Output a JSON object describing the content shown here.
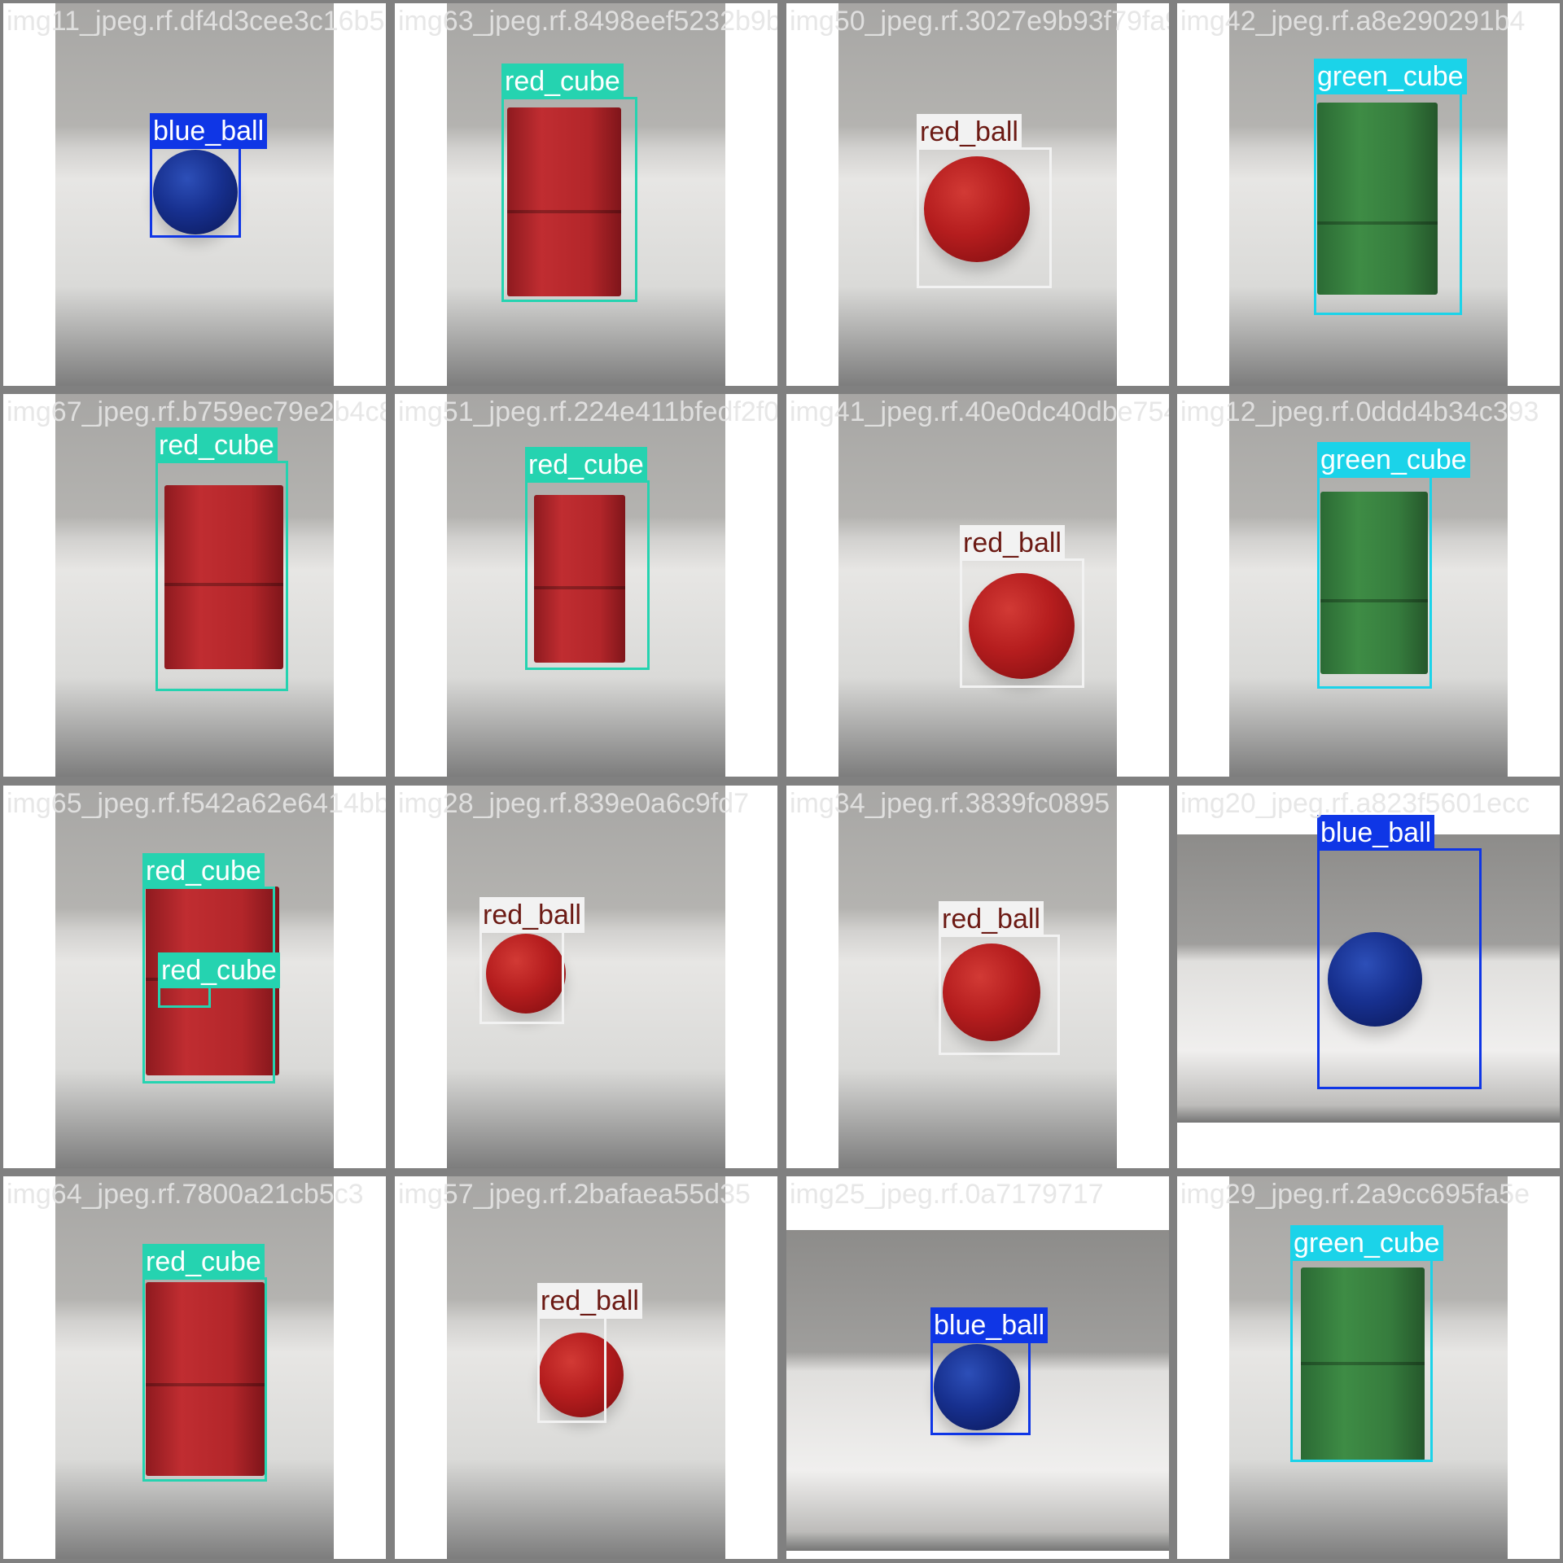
{
  "classes": {
    "red_cube": {
      "label": "red_cube",
      "color": "#25d3b0",
      "text_color": "#ffffff"
    },
    "green_cube": {
      "label": "green_cube",
      "color": "#1bd3e9",
      "text_color": "#ffffff"
    },
    "blue_ball": {
      "label": "blue_ball",
      "color": "#0f36e6",
      "text_color": "#ffffff"
    },
    "red_ball": {
      "label": "red_ball",
      "color": "#f2f2f2",
      "text_color": "#6c1a14"
    }
  },
  "tiles": [
    {
      "filename": "img11_jpeg.rf.df4d3cee3c16b5863",
      "detections": [
        "blue_ball"
      ]
    },
    {
      "filename": "img63_jpeg.rf.8498eef5232b9b0a5",
      "detections": [
        "red_cube"
      ]
    },
    {
      "filename": "img50_jpeg.rf.3027e9b93f79fa90e",
      "detections": [
        "red_ball"
      ]
    },
    {
      "filename": "img42_jpeg.rf.a8e290291b4",
      "detections": [
        "green_cube"
      ]
    },
    {
      "filename": "img67_jpeg.rf.b759ec79e2b4c8915",
      "detections": [
        "red_cube"
      ]
    },
    {
      "filename": "img51_jpeg.rf.224e411bfedf2f0a4",
      "detections": [
        "red_cube"
      ]
    },
    {
      "filename": "img41_jpeg.rf.40e0dc40dbe75481",
      "detections": [
        "red_ball"
      ]
    },
    {
      "filename": "img12_jpeg.rf.0ddd4b34c393",
      "detections": [
        "green_cube"
      ]
    },
    {
      "filename": "img65_jpeg.rf.f542a62e6414bb6",
      "detections": [
        "red_cube",
        "red_cube"
      ]
    },
    {
      "filename": "img28_jpeg.rf.839e0a6c9fd7",
      "detections": [
        "red_ball"
      ]
    },
    {
      "filename": "img34_jpeg.rf.3839fc0895",
      "detections": [
        "red_ball"
      ]
    },
    {
      "filename": "img20_jpeg.rf.a823f5601ecc",
      "detections": [
        "blue_ball"
      ]
    },
    {
      "filename": "img64_jpeg.rf.7800a21cb5c3",
      "detections": [
        "red_cube"
      ]
    },
    {
      "filename": "img57_jpeg.rf.2bafaea55d35",
      "detections": [
        "red_ball"
      ]
    },
    {
      "filename": "img25_jpeg.rf.0a7179717",
      "detections": [
        "blue_ball"
      ]
    },
    {
      "filename": "img29_jpeg.rf.2a9cc695fa5e",
      "detections": [
        "green_cube"
      ]
    }
  ]
}
